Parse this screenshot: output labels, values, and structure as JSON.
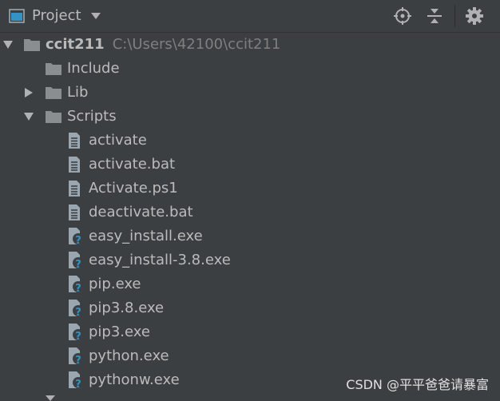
{
  "header": {
    "title": "Project",
    "icons": [
      "project-view-icon",
      "dropdown-icon",
      "locate-icon",
      "collapse-icon",
      "gear-icon"
    ]
  },
  "tree": {
    "root": {
      "name": "ccit211",
      "path": "C:\\Users\\42100\\ccit211",
      "expanded": true
    },
    "folders": [
      {
        "name": "Include",
        "expanded": null
      },
      {
        "name": "Lib",
        "expanded": false
      },
      {
        "name": "Scripts",
        "expanded": true
      }
    ],
    "scripts_files": [
      {
        "name": "activate",
        "icon": "text-file-icon"
      },
      {
        "name": "activate.bat",
        "icon": "text-file-icon"
      },
      {
        "name": "Activate.ps1",
        "icon": "text-file-icon"
      },
      {
        "name": "deactivate.bat",
        "icon": "text-file-icon"
      },
      {
        "name": "easy_install.exe",
        "icon": "unknown-file-icon"
      },
      {
        "name": "easy_install-3.8.exe",
        "icon": "unknown-file-icon"
      },
      {
        "name": "pip.exe",
        "icon": "unknown-file-icon"
      },
      {
        "name": "pip3.8.exe",
        "icon": "unknown-file-icon"
      },
      {
        "name": "pip3.exe",
        "icon": "unknown-file-icon"
      },
      {
        "name": "python.exe",
        "icon": "unknown-file-icon"
      },
      {
        "name": "pythonw.exe",
        "icon": "unknown-file-icon"
      }
    ]
  },
  "watermark": "CSDN @平平爸爸请暴富",
  "colors": {
    "background": "#3c3f41",
    "text": "#bbbbbb",
    "path_text": "#7f7f7f",
    "folder": "#8a8e91",
    "question_mark": "#3592c4"
  }
}
